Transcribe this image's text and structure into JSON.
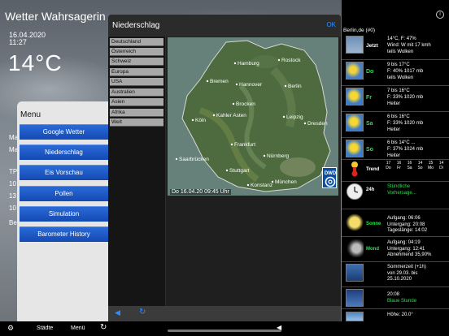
{
  "app": {
    "title": "Wetter Wahrsagerin"
  },
  "background": {
    "date": "16.04.2020",
    "time": "11:27",
    "temperature": "14°C",
    "fragments": [
      "Ma",
      "Ma",
      "TP",
      "10",
      "13",
      "10",
      "Be"
    ]
  },
  "menu": {
    "title": "Menu",
    "items": [
      "Google Wetter",
      "Niederschlag",
      "Eis Vorschau",
      "Pollen",
      "Simulation",
      "Barometer History"
    ]
  },
  "niederschlag": {
    "title": "Niederschlag",
    "ok_label": "OK",
    "regions": [
      "Deutschland",
      "Österreich",
      "Schweiz",
      "Europa",
      "USA",
      "Australien",
      "Asien",
      "Afrika",
      "Welt"
    ],
    "map_caption": "Do 16.04.20  09:45 Uhr",
    "dwd_label": "DWD",
    "cities": [
      "Hamburg",
      "Rostock",
      "Bremen",
      "Hannover",
      "Berlin",
      "Brocken",
      "Leipzig",
      "Dresden",
      "Köln",
      "Kahler Asten",
      "Frankfurt",
      "Nürnberg",
      "Saarbrücken",
      "Stuttgart",
      "Konstanz",
      "München"
    ]
  },
  "forecast": {
    "station": "Berlin,de (#0)",
    "rows": [
      {
        "day": "Jetzt",
        "lines": [
          "14°C, F: 47%",
          "Wind: W mit 17 kmh",
          "teils Wolken"
        ],
        "accent": "white"
      },
      {
        "day": "Do",
        "lines": [
          "9 bis 17°C",
          "F: 40% 1017 mb",
          "teils Wolken"
        ],
        "accent": "green"
      },
      {
        "day": "Fr",
        "lines": [
          "7 bis 16°C",
          "F: 33% 1020 mb",
          "Heiter"
        ],
        "accent": "green"
      },
      {
        "day": "Sa",
        "lines": [
          "6 bis 16°C",
          "F: 33% 1020 mb",
          "Heiter"
        ],
        "accent": "green"
      },
      {
        "day": "So",
        "lines": [
          "6 bis 14°C ...",
          "F: 37% 1024 mb",
          "Heiter"
        ],
        "accent": "green"
      }
    ],
    "trend": {
      "label": "Trend",
      "days": [
        {
          "temp": "17",
          "day": "Do"
        },
        {
          "temp": "16",
          "day": "Fr"
        },
        {
          "temp": "16",
          "day": "Sa"
        },
        {
          "temp": "14",
          "day": "So"
        },
        {
          "temp": "15",
          "day": "Mo"
        },
        {
          "temp": "14",
          "day": "Di"
        }
      ]
    },
    "hourly": {
      "label": "24h",
      "line1": "Stündliche",
      "line2": "Vorhersage..."
    },
    "sun": {
      "label": "Sonne",
      "lines": [
        "Aufgang: 06:06",
        "Untergang: 20:08",
        "Tageslänge: 14:02"
      ]
    },
    "moon": {
      "label": "Mond",
      "lines": [
        "Aufgang: 04:19",
        "Untergang: 12:41",
        "Abnehmend 35,90%"
      ]
    },
    "dst": {
      "lines": [
        "Sommerzeit (+1h)",
        "von 29.03. bis",
        "25.10.2020"
      ]
    },
    "blue_hour": {
      "time": "20:08",
      "label": "Blaue Stunde"
    },
    "altitude": {
      "line1": "Höhe: 20.0°"
    }
  },
  "bottom_bar": {
    "staedte": "Städte",
    "menue": "Menü"
  }
}
